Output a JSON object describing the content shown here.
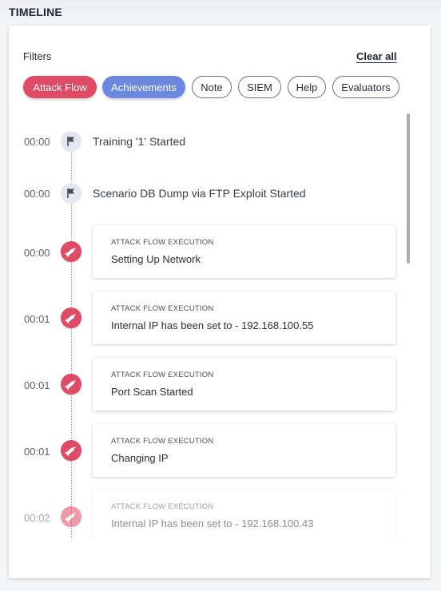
{
  "page": {
    "title": "TIMELINE"
  },
  "filters": {
    "label": "Filters",
    "clear_all": "Clear all",
    "chips": [
      {
        "label": "Attack Flow",
        "state": "active",
        "color": "#df4a64"
      },
      {
        "label": "Achievements",
        "state": "active",
        "color": "#6a88de"
      },
      {
        "label": "Note",
        "state": "inactive"
      },
      {
        "label": "SIEM",
        "state": "inactive"
      },
      {
        "label": "Help",
        "state": "inactive"
      },
      {
        "label": "Evaluators",
        "state": "inactive"
      }
    ]
  },
  "timeline": {
    "events": [
      {
        "time": "00:00",
        "icon": "flag-icon",
        "title": "Training '1' Started"
      },
      {
        "time": "00:00",
        "icon": "flag-icon",
        "title": "Scenario DB Dump via FTP Exploit Started"
      },
      {
        "time": "00:00",
        "icon": "syringe-icon",
        "category": "ATTACK FLOW EXECUTION",
        "title": "Setting Up Network"
      },
      {
        "time": "00:01",
        "icon": "syringe-icon",
        "category": "ATTACK FLOW EXECUTION",
        "title": "Internal IP has been set to - 192.168.100.55"
      },
      {
        "time": "00:01",
        "icon": "syringe-icon",
        "category": "ATTACK FLOW EXECUTION",
        "title": "Port Scan Started"
      },
      {
        "time": "00:01",
        "icon": "syringe-icon",
        "category": "ATTACK FLOW EXECUTION",
        "title": "Changing IP"
      },
      {
        "time": "00:02",
        "icon": "syringe-icon",
        "category": "ATTACK FLOW EXECUTION",
        "title": "Internal IP has been set to - 192.168.100.43"
      }
    ]
  },
  "colors": {
    "attack": "#df4a64",
    "achievements": "#6a88de",
    "flag_bg": "#e4e7ef"
  }
}
